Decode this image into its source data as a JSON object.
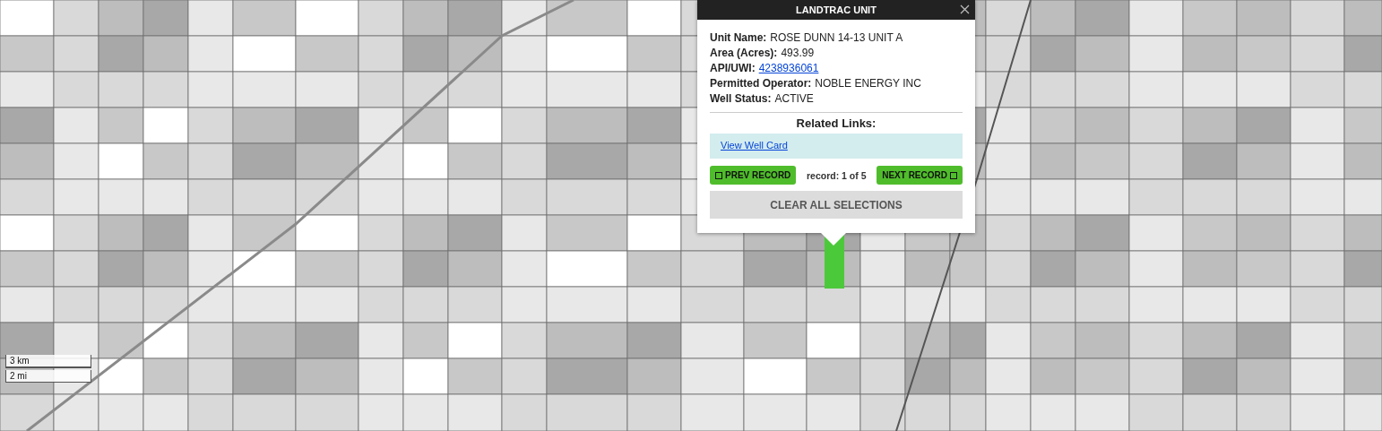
{
  "popup": {
    "title": "LANDTRAC UNIT",
    "fields": [
      {
        "label": "Unit Name:",
        "value": "ROSE DUNN 14-13 UNIT A",
        "kind": "text"
      },
      {
        "label": "Area (Acres):",
        "value": "493.99",
        "kind": "text"
      },
      {
        "label": "API/UWI:",
        "value": "4238936061",
        "kind": "link"
      },
      {
        "label": "Permitted Operator:",
        "value": "NOBLE ENERGY INC",
        "kind": "text"
      },
      {
        "label": "Well Status:",
        "value": "ACTIVE",
        "kind": "text"
      }
    ],
    "related_heading": "Related Links:",
    "links": [
      "View Well Card"
    ],
    "prev_button": "PREV RECORD",
    "record_counter": "record: 1 of 5",
    "next_button": "NEXT RECORD",
    "clear_button": "CLEAR ALL SELECTIONS"
  },
  "scale_bar": [
    "3 km",
    "2 mi"
  ]
}
